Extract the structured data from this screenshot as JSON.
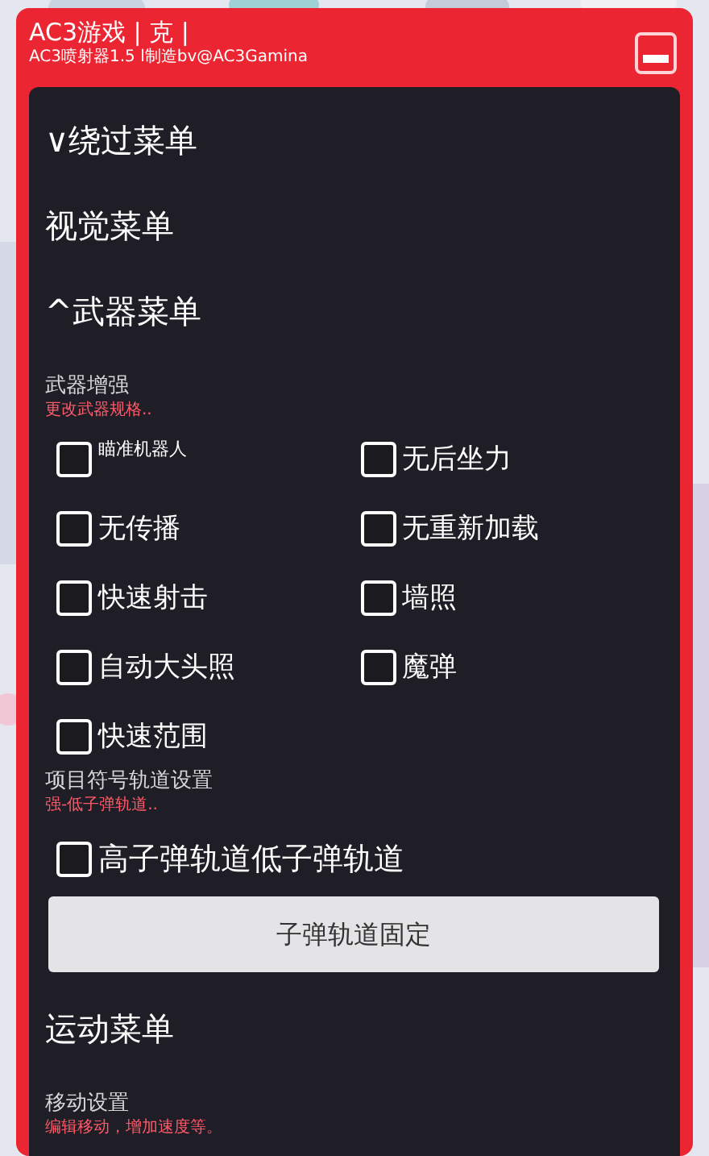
{
  "window": {
    "title": "AC3游戏 | 克 |",
    "subtitle": "AC3喷射器1.5 l制造bv@AC3Gamina"
  },
  "content": [
    {
      "kind": "heading",
      "text": "∨绕过菜单"
    },
    {
      "kind": "heading",
      "text": "视觉菜单"
    },
    {
      "kind": "heading",
      "text": "^武器菜单"
    },
    {
      "kind": "caption",
      "title": "武器增强",
      "hint": "更改武器规格.."
    },
    {
      "kind": "grid",
      "items": [
        {
          "label": "瞄准机器人",
          "checked": false,
          "small": true
        },
        {
          "label": "无后坐力",
          "checked": false,
          "small": false
        },
        {
          "label": "无传播",
          "checked": false,
          "small": false
        },
        {
          "label": "无重新加载",
          "checked": false,
          "small": false
        },
        {
          "label": "快速射击",
          "checked": false,
          "small": false
        },
        {
          "label": "墙照",
          "checked": false,
          "small": false
        },
        {
          "label": "自动大头照",
          "checked": false,
          "small": false
        },
        {
          "label": "魔弹",
          "checked": false,
          "small": false
        },
        {
          "label": "快速范围",
          "checked": false,
          "small": false
        }
      ]
    },
    {
      "kind": "caption",
      "title": "项目符号轨道设置",
      "hint": "强-低子弹轨道.."
    },
    {
      "kind": "checkbox",
      "label": "高子弹轨道低子弹轨道",
      "checked": false
    },
    {
      "kind": "button",
      "label": "子弹轨道固定"
    },
    {
      "kind": "heading",
      "text": "运动菜单"
    },
    {
      "kind": "caption",
      "title": "移动设置",
      "hint": "编辑移动，增加速度等。"
    }
  ]
}
